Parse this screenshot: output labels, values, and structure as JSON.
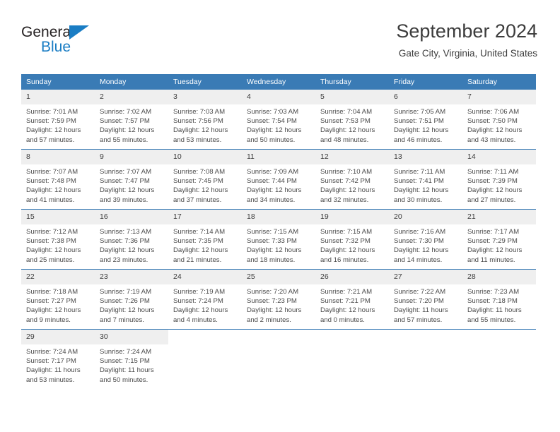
{
  "brand": {
    "name_part1": "General",
    "name_part2": "Blue",
    "triangle_icon": "triangle-icon",
    "accent_color": "#1a7dc4"
  },
  "header": {
    "title": "September 2024",
    "location": "Gate City, Virginia, United States"
  },
  "calendar": {
    "header_bg": "#3a7bb5",
    "daynum_bg": "#efefef",
    "weekday_headers": [
      "Sunday",
      "Monday",
      "Tuesday",
      "Wednesday",
      "Thursday",
      "Friday",
      "Saturday"
    ],
    "weeks": [
      [
        {
          "day": "1",
          "sunrise": "Sunrise: 7:01 AM",
          "sunset": "Sunset: 7:59 PM",
          "daylight_line1": "Daylight: 12 hours",
          "daylight_line2": "and 57 minutes."
        },
        {
          "day": "2",
          "sunrise": "Sunrise: 7:02 AM",
          "sunset": "Sunset: 7:57 PM",
          "daylight_line1": "Daylight: 12 hours",
          "daylight_line2": "and 55 minutes."
        },
        {
          "day": "3",
          "sunrise": "Sunrise: 7:03 AM",
          "sunset": "Sunset: 7:56 PM",
          "daylight_line1": "Daylight: 12 hours",
          "daylight_line2": "and 53 minutes."
        },
        {
          "day": "4",
          "sunrise": "Sunrise: 7:03 AM",
          "sunset": "Sunset: 7:54 PM",
          "daylight_line1": "Daylight: 12 hours",
          "daylight_line2": "and 50 minutes."
        },
        {
          "day": "5",
          "sunrise": "Sunrise: 7:04 AM",
          "sunset": "Sunset: 7:53 PM",
          "daylight_line1": "Daylight: 12 hours",
          "daylight_line2": "and 48 minutes."
        },
        {
          "day": "6",
          "sunrise": "Sunrise: 7:05 AM",
          "sunset": "Sunset: 7:51 PM",
          "daylight_line1": "Daylight: 12 hours",
          "daylight_line2": "and 46 minutes."
        },
        {
          "day": "7",
          "sunrise": "Sunrise: 7:06 AM",
          "sunset": "Sunset: 7:50 PM",
          "daylight_line1": "Daylight: 12 hours",
          "daylight_line2": "and 43 minutes."
        }
      ],
      [
        {
          "day": "8",
          "sunrise": "Sunrise: 7:07 AM",
          "sunset": "Sunset: 7:48 PM",
          "daylight_line1": "Daylight: 12 hours",
          "daylight_line2": "and 41 minutes."
        },
        {
          "day": "9",
          "sunrise": "Sunrise: 7:07 AM",
          "sunset": "Sunset: 7:47 PM",
          "daylight_line1": "Daylight: 12 hours",
          "daylight_line2": "and 39 minutes."
        },
        {
          "day": "10",
          "sunrise": "Sunrise: 7:08 AM",
          "sunset": "Sunset: 7:45 PM",
          "daylight_line1": "Daylight: 12 hours",
          "daylight_line2": "and 37 minutes."
        },
        {
          "day": "11",
          "sunrise": "Sunrise: 7:09 AM",
          "sunset": "Sunset: 7:44 PM",
          "daylight_line1": "Daylight: 12 hours",
          "daylight_line2": "and 34 minutes."
        },
        {
          "day": "12",
          "sunrise": "Sunrise: 7:10 AM",
          "sunset": "Sunset: 7:42 PM",
          "daylight_line1": "Daylight: 12 hours",
          "daylight_line2": "and 32 minutes."
        },
        {
          "day": "13",
          "sunrise": "Sunrise: 7:11 AM",
          "sunset": "Sunset: 7:41 PM",
          "daylight_line1": "Daylight: 12 hours",
          "daylight_line2": "and 30 minutes."
        },
        {
          "day": "14",
          "sunrise": "Sunrise: 7:11 AM",
          "sunset": "Sunset: 7:39 PM",
          "daylight_line1": "Daylight: 12 hours",
          "daylight_line2": "and 27 minutes."
        }
      ],
      [
        {
          "day": "15",
          "sunrise": "Sunrise: 7:12 AM",
          "sunset": "Sunset: 7:38 PM",
          "daylight_line1": "Daylight: 12 hours",
          "daylight_line2": "and 25 minutes."
        },
        {
          "day": "16",
          "sunrise": "Sunrise: 7:13 AM",
          "sunset": "Sunset: 7:36 PM",
          "daylight_line1": "Daylight: 12 hours",
          "daylight_line2": "and 23 minutes."
        },
        {
          "day": "17",
          "sunrise": "Sunrise: 7:14 AM",
          "sunset": "Sunset: 7:35 PM",
          "daylight_line1": "Daylight: 12 hours",
          "daylight_line2": "and 21 minutes."
        },
        {
          "day": "18",
          "sunrise": "Sunrise: 7:15 AM",
          "sunset": "Sunset: 7:33 PM",
          "daylight_line1": "Daylight: 12 hours",
          "daylight_line2": "and 18 minutes."
        },
        {
          "day": "19",
          "sunrise": "Sunrise: 7:15 AM",
          "sunset": "Sunset: 7:32 PM",
          "daylight_line1": "Daylight: 12 hours",
          "daylight_line2": "and 16 minutes."
        },
        {
          "day": "20",
          "sunrise": "Sunrise: 7:16 AM",
          "sunset": "Sunset: 7:30 PM",
          "daylight_line1": "Daylight: 12 hours",
          "daylight_line2": "and 14 minutes."
        },
        {
          "day": "21",
          "sunrise": "Sunrise: 7:17 AM",
          "sunset": "Sunset: 7:29 PM",
          "daylight_line1": "Daylight: 12 hours",
          "daylight_line2": "and 11 minutes."
        }
      ],
      [
        {
          "day": "22",
          "sunrise": "Sunrise: 7:18 AM",
          "sunset": "Sunset: 7:27 PM",
          "daylight_line1": "Daylight: 12 hours",
          "daylight_line2": "and 9 minutes."
        },
        {
          "day": "23",
          "sunrise": "Sunrise: 7:19 AM",
          "sunset": "Sunset: 7:26 PM",
          "daylight_line1": "Daylight: 12 hours",
          "daylight_line2": "and 7 minutes."
        },
        {
          "day": "24",
          "sunrise": "Sunrise: 7:19 AM",
          "sunset": "Sunset: 7:24 PM",
          "daylight_line1": "Daylight: 12 hours",
          "daylight_line2": "and 4 minutes."
        },
        {
          "day": "25",
          "sunrise": "Sunrise: 7:20 AM",
          "sunset": "Sunset: 7:23 PM",
          "daylight_line1": "Daylight: 12 hours",
          "daylight_line2": "and 2 minutes."
        },
        {
          "day": "26",
          "sunrise": "Sunrise: 7:21 AM",
          "sunset": "Sunset: 7:21 PM",
          "daylight_line1": "Daylight: 12 hours",
          "daylight_line2": "and 0 minutes."
        },
        {
          "day": "27",
          "sunrise": "Sunrise: 7:22 AM",
          "sunset": "Sunset: 7:20 PM",
          "daylight_line1": "Daylight: 11 hours",
          "daylight_line2": "and 57 minutes."
        },
        {
          "day": "28",
          "sunrise": "Sunrise: 7:23 AM",
          "sunset": "Sunset: 7:18 PM",
          "daylight_line1": "Daylight: 11 hours",
          "daylight_line2": "and 55 minutes."
        }
      ],
      [
        {
          "day": "29",
          "sunrise": "Sunrise: 7:24 AM",
          "sunset": "Sunset: 7:17 PM",
          "daylight_line1": "Daylight: 11 hours",
          "daylight_line2": "and 53 minutes."
        },
        {
          "day": "30",
          "sunrise": "Sunrise: 7:24 AM",
          "sunset": "Sunset: 7:15 PM",
          "daylight_line1": "Daylight: 11 hours",
          "daylight_line2": "and 50 minutes."
        },
        {
          "day": "",
          "sunrise": "",
          "sunset": "",
          "daylight_line1": "",
          "daylight_line2": ""
        },
        {
          "day": "",
          "sunrise": "",
          "sunset": "",
          "daylight_line1": "",
          "daylight_line2": ""
        },
        {
          "day": "",
          "sunrise": "",
          "sunset": "",
          "daylight_line1": "",
          "daylight_line2": ""
        },
        {
          "day": "",
          "sunrise": "",
          "sunset": "",
          "daylight_line1": "",
          "daylight_line2": ""
        },
        {
          "day": "",
          "sunrise": "",
          "sunset": "",
          "daylight_line1": "",
          "daylight_line2": ""
        }
      ]
    ]
  }
}
